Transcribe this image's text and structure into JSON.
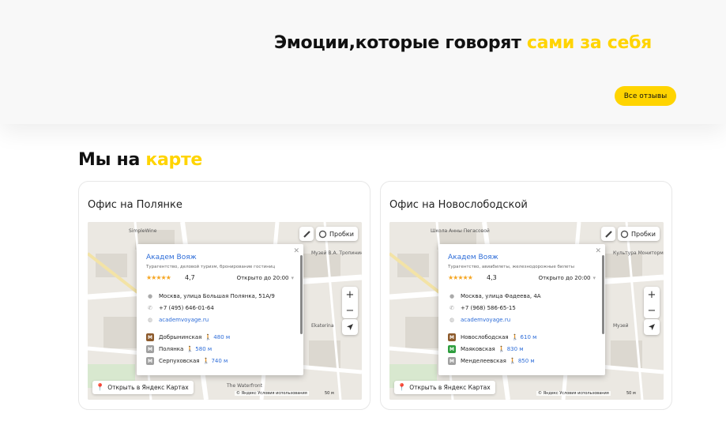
{
  "hero": {
    "title_main": "Эмоции,которые говорят ",
    "title_accent": "сами за себя",
    "reviews_button": "Все отзывы"
  },
  "map_section": {
    "title_main": "Мы на ",
    "title_accent": "карте"
  },
  "offices": [
    {
      "title": "Офис на Полянке",
      "org_name": "Академ Вояж",
      "category": "Турагентство, деловой туризм, бронирование гостиниц",
      "rating": "4,7",
      "hours": "Открыто до 20:00",
      "address": "Москва, улица Большая Полянка, 51А/9",
      "phone": "+7 (495) 646-01-64",
      "website": "academvoyage.ru",
      "metro": [
        {
          "name": "Добрынинская",
          "dist": "480 м",
          "color": "#8d5b2d"
        },
        {
          "name": "Полянка",
          "dist": "580 м",
          "color": "#a0a0a0"
        },
        {
          "name": "Серпуховская",
          "dist": "740 м",
          "color": "#a0a0a0"
        }
      ],
      "traffic_label": "Пробки",
      "open_maps": "Открыть в Яндекс Картах",
      "copyright": "© Яндекс   Условия использования",
      "scale": "50 м",
      "labels": [
        "SimpleWine",
        "Музей В.А. Тропинина",
        "Ekaterina",
        "The Waterfront"
      ]
    },
    {
      "title": "Офис на Новослободской",
      "org_name": "Академ Вояж",
      "category": "Турагентство, авиабилеты, железнодорожные билеты",
      "rating": "4,3",
      "hours": "Открыто до 20:00",
      "address": "Москва, улица Фадеева, 4А",
      "phone": "+7 (968) 586-65-15",
      "website": "academvoyage.ru",
      "metro": [
        {
          "name": "Новослободская",
          "dist": "610 м",
          "color": "#8d5b2d"
        },
        {
          "name": "Маяковская",
          "dist": "830 м",
          "color": "#2e9e3e"
        },
        {
          "name": "Менделеевская",
          "dist": "850 м",
          "color": "#a0a0a0"
        }
      ],
      "traffic_label": "Пробки",
      "open_maps": "Открыть в Яндекс Картах",
      "copyright": "© Яндекс   Условия использования",
      "scale": "50 м",
      "labels": [
        "Школа Анны Пегасовой",
        "Культура Мониторм",
        "Музей"
      ]
    }
  ],
  "colors": {
    "accent": "#ffd400",
    "link": "#2e6dd8",
    "star": "#f5a623"
  }
}
